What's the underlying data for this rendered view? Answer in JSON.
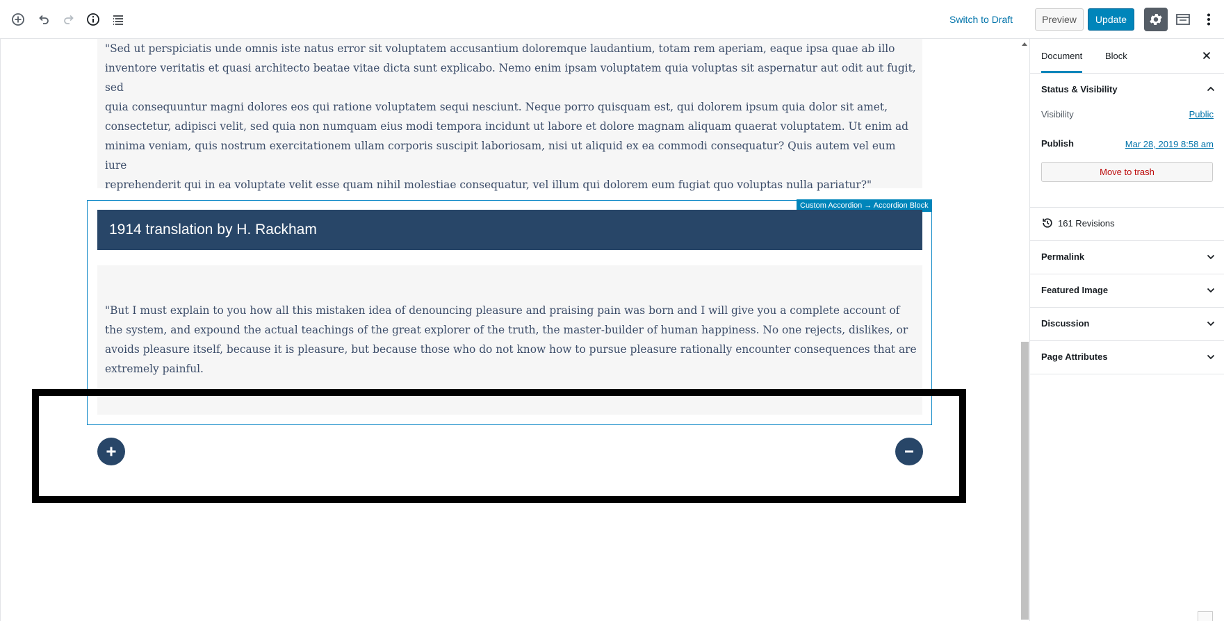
{
  "toolbar": {
    "icons": [
      "add-block-icon",
      "undo-icon",
      "redo-icon",
      "info-icon",
      "block-navigation-icon"
    ],
    "switch_to_draft": "Switch to Draft",
    "preview": "Preview",
    "update": "Update",
    "settings_icon": "gear-icon",
    "fullscreen_icon": "fullscreen-icon",
    "more_icon": "more-vertical-icon"
  },
  "editor": {
    "quote_text": "\"Sed ut perspiciatis unde omnis iste natus error sit voluptatem accusantium doloremque laudantium, totam rem aperiam, eaque ipsa quae ab illo\ninventore veritatis et quasi architecto beatae vitae dicta sunt explicabo. Nemo enim ipsam voluptatem quia voluptas sit aspernatur aut odit aut fugit, sed\nquia consequuntur magni dolores eos qui ratione voluptatem sequi nesciunt. Neque porro quisquam est, qui dolorem ipsum quia dolor sit amet,\nconsectetur, adipisci velit, sed quia non numquam eius modi tempora incidunt ut labore et dolore magnam aliquam quaerat voluptatem. Ut enim ad\nminima veniam, quis nostrum exercitationem ullam corporis suscipit laboriosam, nisi ut aliquid ex ea commodi consequatur? Quis autem vel eum iure\nreprehenderit qui in ea voluptate velit esse quam nihil molestiae consequatur, vel illum qui dolorem eum fugiat quo voluptas nulla pariatur?\"",
    "block_label": "Custom Accordion → Accordion Block",
    "accordion_title": "1914 translation by H. Rackham",
    "accordion_text": "\"But I must explain to you how all this mistaken idea of denouncing pleasure and praising pain was born and I will give you a complete account of the system, and expound the actual teachings of the great explorer of the truth, the master-builder of human happiness. No one rejects, dislikes, or avoids pleasure itself, because it is pleasure, but because those who do not know how to pursue pleasure rationally encounter consequences that are extremely painful.",
    "add_icon": "plus-circle-icon",
    "remove_icon": "minus-circle-icon"
  },
  "sidebar": {
    "tabs": [
      {
        "label": "Document",
        "active": true
      },
      {
        "label": "Block",
        "active": false
      }
    ],
    "status_visibility": {
      "title": "Status & Visibility",
      "visibility_label": "Visibility",
      "visibility_value": "Public",
      "publish_label": "Publish",
      "publish_value": "Mar 28, 2019 8:58 am",
      "trash": "Move to trash"
    },
    "revisions": "161 Revisions",
    "panels": [
      "Permalink",
      "Featured Image",
      "Discussion",
      "Page Attributes"
    ]
  },
  "colors": {
    "accent": "#0085ba",
    "accordion": "#284668",
    "text": "#3c4d69",
    "danger": "#bc0b0b"
  }
}
